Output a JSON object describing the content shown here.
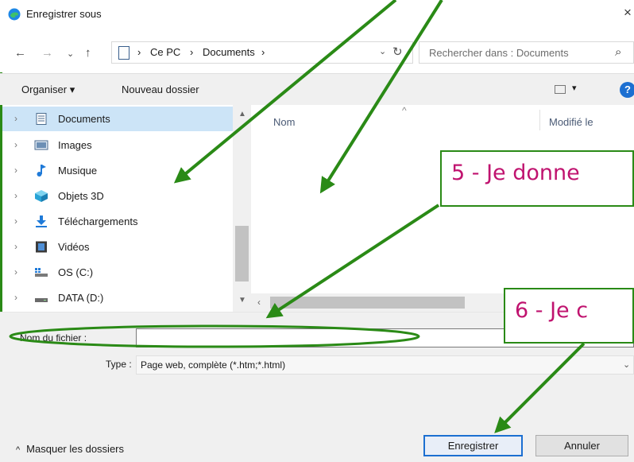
{
  "window": {
    "title": "Enregistrer sous",
    "close_glyph": "×"
  },
  "address": {
    "crumbs": [
      "Ce PC",
      "Documents"
    ],
    "separator": "›",
    "search_placeholder": "Rechercher dans : Documents"
  },
  "toolbar": {
    "organize_label": "Organiser ▾",
    "new_folder_label": "Nouveau dossier",
    "view_dd": "▾",
    "help_label": "?"
  },
  "sidebar": {
    "items": [
      {
        "label": "Documents",
        "icon": "documents-icon",
        "selected": true
      },
      {
        "label": "Images",
        "icon": "images-icon"
      },
      {
        "label": "Musique",
        "icon": "music-icon"
      },
      {
        "label": "Objets 3D",
        "icon": "3d-objects-icon"
      },
      {
        "label": "Téléchargements",
        "icon": "downloads-icon"
      },
      {
        "label": "Vidéos",
        "icon": "videos-icon"
      },
      {
        "label": "OS (C:)",
        "icon": "os-drive-icon"
      },
      {
        "label": "DATA (D:)",
        "icon": "data-drive-icon"
      }
    ]
  },
  "filelist": {
    "columns": [
      "Nom",
      "Modifié le"
    ]
  },
  "form": {
    "filename_label": "Nom du fichier :",
    "filename_value": "",
    "type_label": "Type :",
    "type_value": "Page web, complète (*.htm;*.html)"
  },
  "footer": {
    "hide_folders_label": "Masquer les dossiers",
    "save_label": "Enregistrer",
    "cancel_label": "Annuler"
  },
  "annotations": {
    "callout_5": "5 -  Je donne",
    "callout_6": "6 - Je c"
  },
  "colors": {
    "annotation_green": "#2a8a16",
    "callout_text": "#c0136f",
    "selection": "#cce4f7",
    "accent": "#1c6fd1"
  }
}
